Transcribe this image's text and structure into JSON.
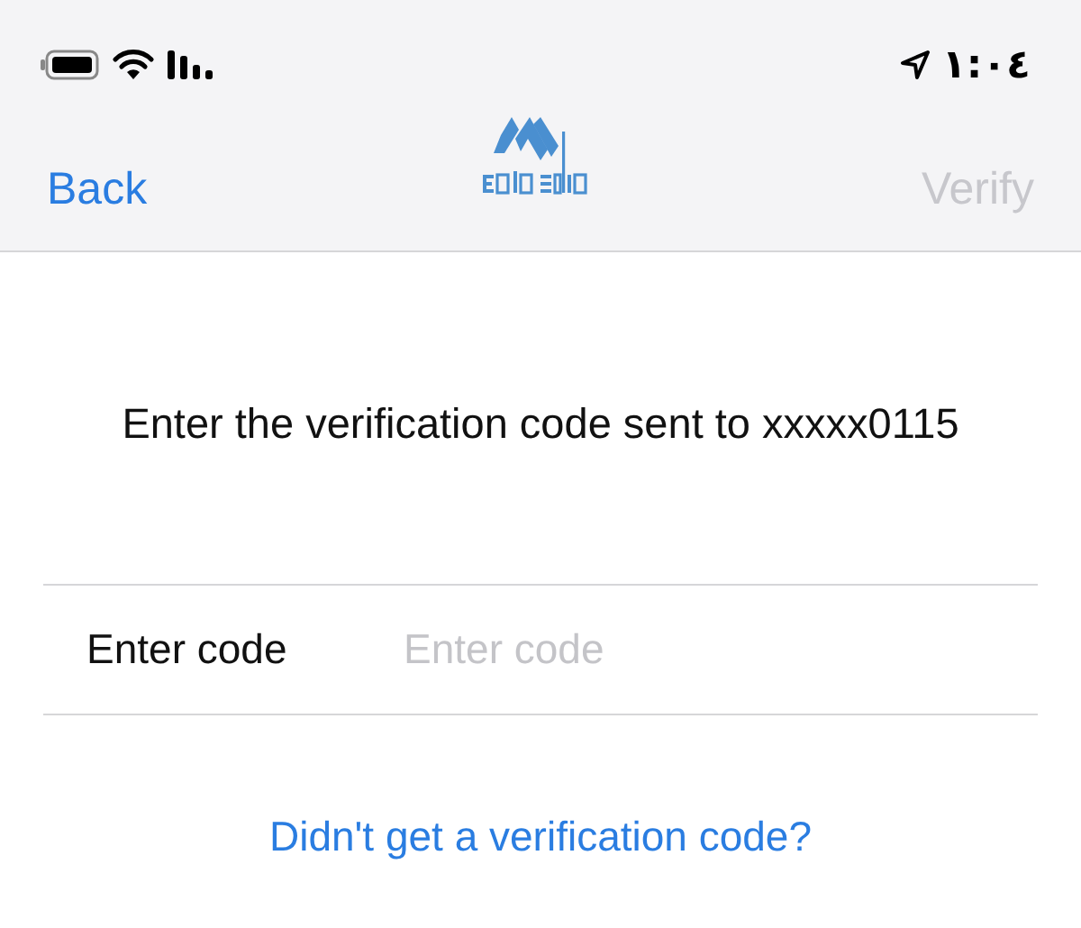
{
  "status_bar": {
    "time": "١:٠٤"
  },
  "nav_bar": {
    "back": "Back",
    "action": {
      "label": "Verify",
      "disabled": true
    }
  },
  "instruction": "Enter the verification code sent to xxxxx0115",
  "code_field": {
    "label": "Enter code",
    "placeholder": "Enter code"
  },
  "resend_link": "Didn't get a verification code?"
}
